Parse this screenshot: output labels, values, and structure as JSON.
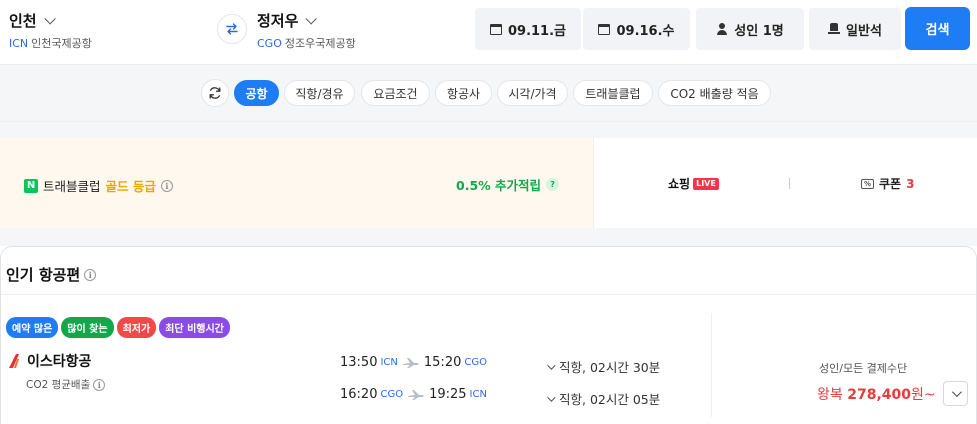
{
  "search": {
    "origin": {
      "city": "인천",
      "code": "ICN",
      "airport": "인천국제공항"
    },
    "destination": {
      "city": "정저우",
      "code": "CGO",
      "airport": "정조우국제공항"
    },
    "depart_date": "09.11.금",
    "return_date": "09.16.수",
    "passengers": "성인 1명",
    "cabin": "일반석",
    "search_label": "검색"
  },
  "filters": {
    "chips": [
      "공항",
      "직항/경유",
      "요금조건",
      "항공사",
      "시각/가격",
      "트래블클럽",
      "CO2 배출량 적음"
    ],
    "active_index": 0
  },
  "promo": {
    "logo_letter": "N",
    "title_prefix": "트래블클럽",
    "title_grade": "골드 등급",
    "point_text": "0.5% 추가적립",
    "point_help": "?",
    "shopping_label": "쇼핑",
    "live_label": "LIVE",
    "coupon_icon_text": "%",
    "coupon_label": "쿠폰",
    "coupon_count": "3"
  },
  "popular": {
    "title": "인기 항공편",
    "info_glyph": "i",
    "badges": [
      {
        "label": "예약 많은",
        "color": "#1e7cf5"
      },
      {
        "label": "많이 찾는",
        "color": "#13a74b"
      },
      {
        "label": "최저가",
        "color": "#ef4a4a"
      },
      {
        "label": "최단 비행시간",
        "color": "#8b4be8"
      }
    ],
    "flight": {
      "airline": "이스타항공",
      "co2": "CO2 평균배출",
      "legs": [
        {
          "dep_time": "13:50",
          "dep_ap": "ICN",
          "arr_time": "15:20",
          "arr_ap": "CGO",
          "info": "직항, 02시간 30분"
        },
        {
          "dep_time": "16:20",
          "dep_ap": "CGO",
          "arr_time": "19:25",
          "arr_ap": "ICN",
          "info": "직항, 02시간 05분"
        }
      ],
      "pay_label": "성인/모든 결제수단",
      "price_prefix": "왕복",
      "price": "278,400",
      "price_suffix": "원~"
    }
  },
  "colors": {
    "accent": "#1e7cf5",
    "price": "#e83b3b",
    "point": "#13a74b",
    "gold": "#f0a500"
  }
}
